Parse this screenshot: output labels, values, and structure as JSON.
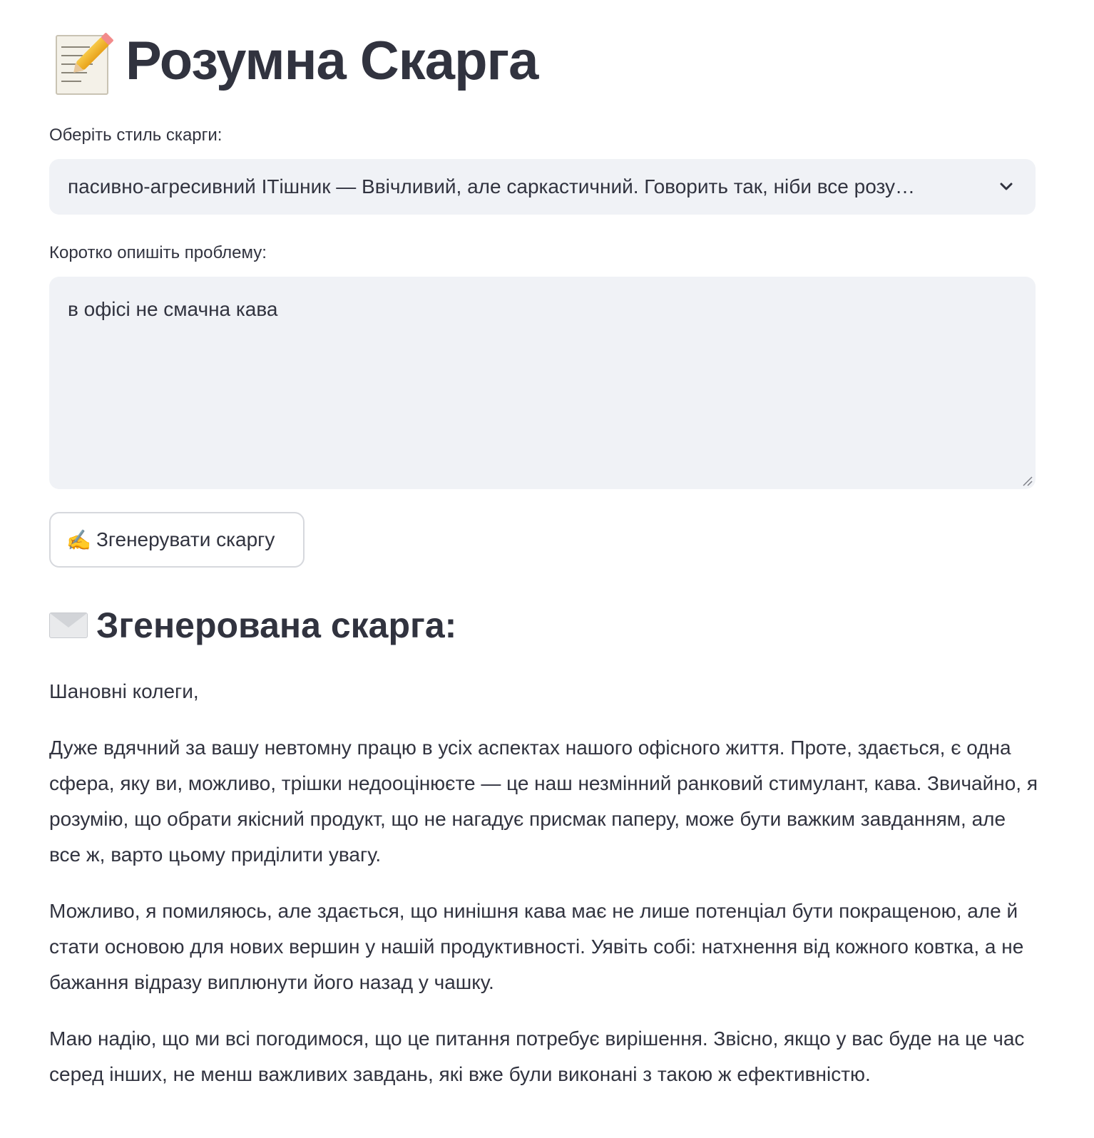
{
  "header": {
    "title": "Розумна Скарга",
    "title_icon": "memo-icon"
  },
  "style_select": {
    "label": "Оберіть стиль скарги:",
    "selected_value": "пасивно-агресивний ІТішник — Ввічливий, але саркастичний. Говорить так, ніби все розу…"
  },
  "problem_input": {
    "label": "Коротко опишіть проблему:",
    "value": "в офісі не смачна кава"
  },
  "generate_button": {
    "icon": "✍️",
    "label": "Згенерувати скаргу"
  },
  "result": {
    "heading": "Згенерована скарга:",
    "heading_icon": "envelope-icon",
    "paragraphs": [
      "Шановні колеги,",
      "Дуже вдячний за вашу невтомну працю в усіх аспектах нашого офісного життя. Проте, здається, є одна сфера, яку ви, можливо, трішки недооцінюєте — це наш незмінний ранковий стимулант, кава. Звичайно, я розумію, що обрати якісний продукт, що не нагадує присмак паперу, може бути важким завданням, але все ж, варто цьому приділити увагу.",
      "Можливо, я помиляюсь, але здається, що нинішня кава має не лише потенціал бути покращеною, але й стати основою для нових вершин у нашій продуктивності. Уявіть собі: натхнення від кожного ковтка, а не бажання відразу виплюнути його назад у чашку.",
      "Маю надію, що ми всі погодимося, що це питання потребує вирішення. Звісно, якщо у вас буде на це час серед інших, не менш важливих завдань, які вже були виконані з такою ж ефективністю."
    ]
  },
  "colors": {
    "text": "#31333f",
    "input_background": "#f0f2f6",
    "button_border": "#d6d8dd"
  }
}
